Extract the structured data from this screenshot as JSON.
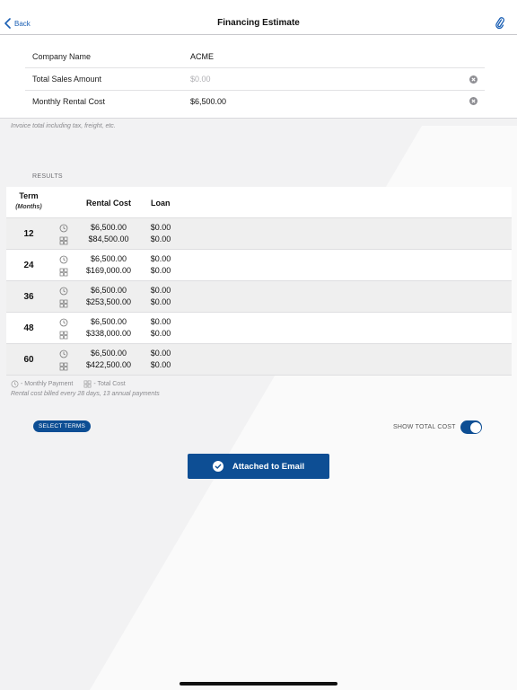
{
  "nav": {
    "back_label": "Back",
    "title": "Financing Estimate"
  },
  "form": {
    "company_label": "Company Name",
    "company_value": "ACME",
    "sales_label": "Total Sales Amount",
    "sales_placeholder": "$0.00",
    "rental_label": "Monthly Rental Cost",
    "rental_value": "$6,500.00"
  },
  "hint": "Invoice total including tax, freight, etc.",
  "results_label": "RESULTS",
  "table": {
    "term_header": "Term",
    "months_header": "(Months)",
    "rental_header": "Rental Cost",
    "loan_header": "Loan",
    "rows": [
      {
        "term": "12",
        "monthly_rental": "$6,500.00",
        "total_rental": "$84,500.00",
        "monthly_loan": "$0.00",
        "total_loan": "$0.00"
      },
      {
        "term": "24",
        "monthly_rental": "$6,500.00",
        "total_rental": "$169,000.00",
        "monthly_loan": "$0.00",
        "total_loan": "$0.00"
      },
      {
        "term": "36",
        "monthly_rental": "$6,500.00",
        "total_rental": "$253,500.00",
        "monthly_loan": "$0.00",
        "total_loan": "$0.00"
      },
      {
        "term": "48",
        "monthly_rental": "$6,500.00",
        "total_rental": "$338,000.00",
        "monthly_loan": "$0.00",
        "total_loan": "$0.00"
      },
      {
        "term": "60",
        "monthly_rental": "$6,500.00",
        "total_rental": "$422,500.00",
        "monthly_loan": "$0.00",
        "total_loan": "$0.00"
      }
    ]
  },
  "legend": {
    "monthly": "- Monthly Payment",
    "total": "- Total Cost"
  },
  "note": "Rental cost billed every 28 days, 13 annual payments",
  "controls": {
    "select_terms": "SELECT TERMS",
    "show_total_cost": "SHOW TOTAL COST",
    "show_total_cost_on": true
  },
  "email_button": "Attached to Email",
  "icons": {
    "back": "chevron-left-icon",
    "attachment": "paperclip-icon",
    "clear": "clear-circle-icon",
    "monthly": "clock-icon",
    "total": "grid-icon",
    "check": "checkmark-circle-icon"
  },
  "colors": {
    "accent": "#0d4e94",
    "link": "#1a5fb4"
  }
}
